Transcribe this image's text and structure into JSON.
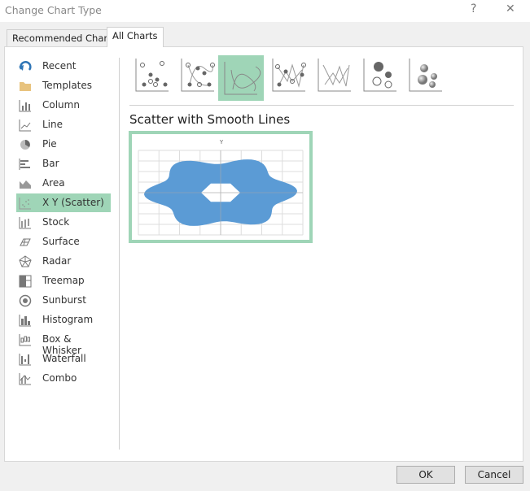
{
  "window": {
    "title": "Change Chart Type",
    "help_label": "?",
    "close_label": "✕"
  },
  "tabs": [
    {
      "label": "Recommended Charts"
    },
    {
      "label": "All Charts",
      "active": true
    }
  ],
  "sidebar": {
    "selected": "X Y (Scatter)",
    "items": [
      {
        "label": "Recent",
        "icon": "recent-icon"
      },
      {
        "label": "Templates",
        "icon": "folder-icon"
      },
      {
        "label": "Column",
        "icon": "column-chart-icon"
      },
      {
        "label": "Line",
        "icon": "line-chart-icon"
      },
      {
        "label": "Pie",
        "icon": "pie-chart-icon"
      },
      {
        "label": "Bar",
        "icon": "bar-chart-icon"
      },
      {
        "label": "Area",
        "icon": "area-chart-icon"
      },
      {
        "label": "X Y (Scatter)",
        "icon": "scatter-chart-icon"
      },
      {
        "label": "Stock",
        "icon": "stock-chart-icon"
      },
      {
        "label": "Surface",
        "icon": "surface-chart-icon"
      },
      {
        "label": "Radar",
        "icon": "radar-chart-icon"
      },
      {
        "label": "Treemap",
        "icon": "treemap-chart-icon"
      },
      {
        "label": "Sunburst",
        "icon": "sunburst-chart-icon"
      },
      {
        "label": "Histogram",
        "icon": "histogram-chart-icon"
      },
      {
        "label": "Box & Whisker",
        "icon": "box-whisker-chart-icon"
      },
      {
        "label": "Waterfall",
        "icon": "waterfall-chart-icon"
      },
      {
        "label": "Combo",
        "icon": "combo-chart-icon"
      }
    ]
  },
  "subtypes": [
    "scatter",
    "scatter-smooth-lines-markers",
    "scatter-smooth-lines",
    "scatter-straight-lines-markers",
    "scatter-straight-lines",
    "bubble",
    "3d-bubble"
  ],
  "selected_subtype_index": 2,
  "main": {
    "subtype_title": "Scatter with Smooth Lines",
    "preview_axis_label": "Y"
  },
  "colors": {
    "selection": "#9fd5b7",
    "series": "#5b9bd5"
  },
  "buttons": {
    "ok": "OK",
    "cancel": "Cancel"
  }
}
